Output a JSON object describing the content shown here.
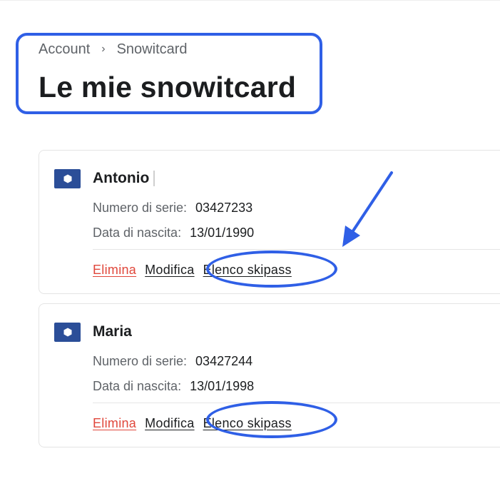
{
  "breadcrumb": {
    "items": [
      "Account",
      "Snowitcard"
    ],
    "separator": "›"
  },
  "page_title": "Le mie snowitcard",
  "cards": [
    {
      "name": "Antonio",
      "serial_label": "Numero di serie:",
      "serial_value": "03427233",
      "birth_label": "Data di nascita:",
      "birth_value": "13/01/1990",
      "actions": {
        "delete": "Elimina",
        "edit": "Modifica",
        "skipass": "Elenco skipass"
      }
    },
    {
      "name": "Maria",
      "serial_label": "Numero di serie:",
      "serial_value": "03427244",
      "birth_label": "Data di nascita:",
      "birth_value": "13/01/1998",
      "actions": {
        "delete": "Elimina",
        "edit": "Modifica",
        "skipass": "Elenco skipass"
      }
    }
  ],
  "colors": {
    "highlight": "#2f5fe6",
    "card_icon": "#2b4e98",
    "delete_link": "#e0473b"
  },
  "icons": {
    "card_icon": "hexagon-icon",
    "breadcrumb_separator": "chevron-right-icon",
    "annotation": "arrow-annotation"
  }
}
